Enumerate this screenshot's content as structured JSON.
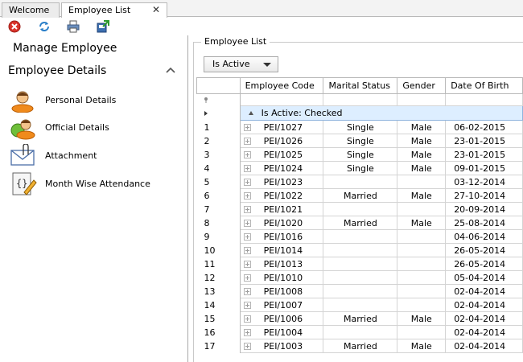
{
  "tabs": [
    {
      "label": "Welcome"
    },
    {
      "label": "Employee List"
    }
  ],
  "tab_close": "✕",
  "toolbar": {
    "icons": [
      "close-red-icon",
      "refresh-icon",
      "print-icon",
      "export-icon"
    ]
  },
  "sidebar": {
    "title": "Manage Employee",
    "section": "Employee Details",
    "items": [
      {
        "label": "Personal Details",
        "icon": "person-icon"
      },
      {
        "label": "Official Details",
        "icon": "official-person-icon"
      },
      {
        "label": "Attachment",
        "icon": "attachment-icon"
      },
      {
        "label": "Month Wise Attendance",
        "icon": "attendance-icon"
      }
    ]
  },
  "main": {
    "group_caption": "Employee List",
    "filter_dropdown": "Is Active",
    "columns": [
      "Employee Code",
      "Marital Status",
      "Gender",
      "Date Of Birth"
    ],
    "group_label": "Is Active: Checked",
    "rows": [
      {
        "n": "1",
        "code": "PEI/1027",
        "marital": "Single",
        "gender": "Male",
        "dob": "06-02-2015"
      },
      {
        "n": "2",
        "code": "PEI/1026",
        "marital": "Single",
        "gender": "Male",
        "dob": "23-01-2015"
      },
      {
        "n": "3",
        "code": "PEI/1025",
        "marital": "Single",
        "gender": "Male",
        "dob": "23-01-2015"
      },
      {
        "n": "4",
        "code": "PEI/1024",
        "marital": "Single",
        "gender": "Male",
        "dob": "09-01-2015"
      },
      {
        "n": "5",
        "code": "PEI/1023",
        "marital": "",
        "gender": "",
        "dob": "03-12-2014"
      },
      {
        "n": "6",
        "code": "PEI/1022",
        "marital": "Married",
        "gender": "Male",
        "dob": "27-10-2014"
      },
      {
        "n": "7",
        "code": "PEI/1021",
        "marital": "",
        "gender": "",
        "dob": "20-09-2014"
      },
      {
        "n": "8",
        "code": "PEI/1020",
        "marital": "Married",
        "gender": "Male",
        "dob": "25-08-2014"
      },
      {
        "n": "9",
        "code": "PEI/1016",
        "marital": "",
        "gender": "",
        "dob": "04-06-2014"
      },
      {
        "n": "10",
        "code": "PEI/1014",
        "marital": "",
        "gender": "",
        "dob": "26-05-2014"
      },
      {
        "n": "11",
        "code": "PEI/1013",
        "marital": "",
        "gender": "",
        "dob": "26-05-2014"
      },
      {
        "n": "12",
        "code": "PEI/1010",
        "marital": "",
        "gender": "",
        "dob": "05-04-2014"
      },
      {
        "n": "13",
        "code": "PEI/1008",
        "marital": "",
        "gender": "",
        "dob": "02-04-2014"
      },
      {
        "n": "14",
        "code": "PEI/1007",
        "marital": "",
        "gender": "",
        "dob": "02-04-2014"
      },
      {
        "n": "15",
        "code": "PEI/1006",
        "marital": "Married",
        "gender": "Male",
        "dob": "02-04-2014"
      },
      {
        "n": "16",
        "code": "PEI/1004",
        "marital": "",
        "gender": "",
        "dob": "02-04-2014"
      },
      {
        "n": "17",
        "code": "PEI/1003",
        "marital": "Married",
        "gender": "Male",
        "dob": "02-04-2014"
      }
    ]
  }
}
